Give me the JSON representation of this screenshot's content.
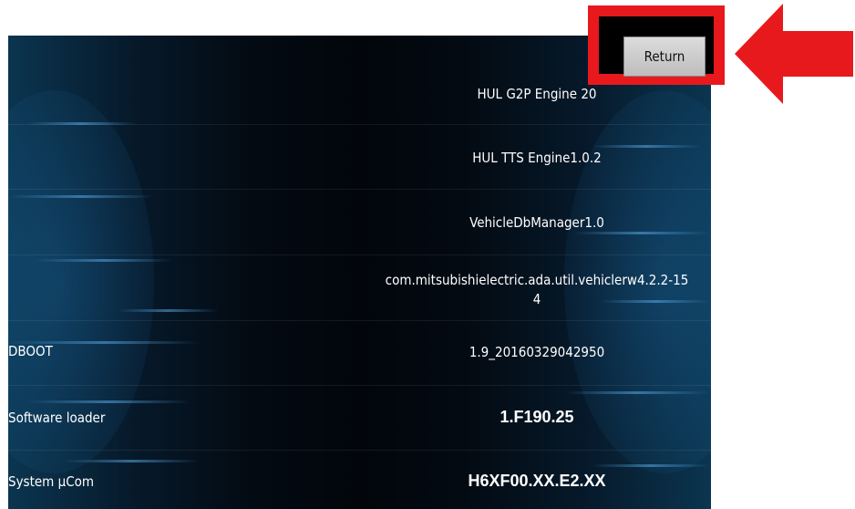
{
  "return_button_label": "Return",
  "info_rows": [
    {
      "label": "",
      "value": "HUL G2P Engine 20"
    },
    {
      "label": "",
      "value": "HUL TTS Engine1.0.2"
    },
    {
      "label": "",
      "value": "VehicleDbManager1.0"
    },
    {
      "label": "",
      "value": "com.mitsubishielectric.ada.util.vehiclerw4.2.2-15\n4"
    },
    {
      "label": "DBOOT",
      "value": "1.9_20160329042950"
    },
    {
      "label": "Software loader",
      "value": "1.F190.25"
    },
    {
      "label": "System µCom",
      "value": "H6XF00.XX.E2.XX"
    }
  ],
  "annotation": {
    "highlight_color": "#e8191d",
    "arrow_color": "#e8191d"
  }
}
